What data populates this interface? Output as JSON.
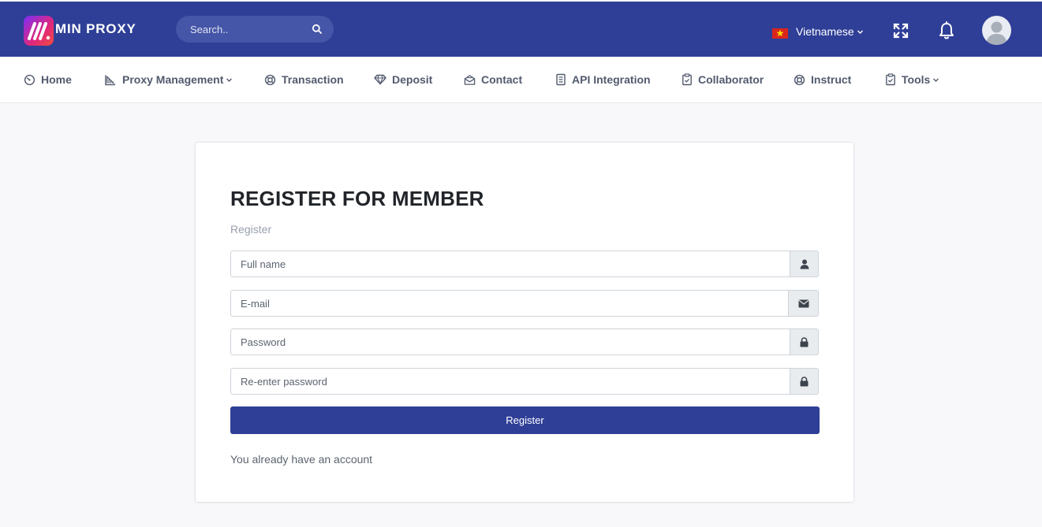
{
  "header": {
    "brand": "MIN PROXY",
    "search_placeholder": "Search..",
    "language": "Vietnamese"
  },
  "nav": [
    {
      "label": "Home",
      "icon": "dashboard-icon"
    },
    {
      "label": "Proxy Management",
      "icon": "chart-icon",
      "dropdown": true
    },
    {
      "label": "Transaction",
      "icon": "lifebuoy-icon"
    },
    {
      "label": "Deposit",
      "icon": "diamond-icon"
    },
    {
      "label": "Contact",
      "icon": "envelope-open-icon"
    },
    {
      "label": "API Integration",
      "icon": "document-icon"
    },
    {
      "label": "Collaborator",
      "icon": "clipboard-icon"
    },
    {
      "label": "Instruct",
      "icon": "lifebuoy-icon"
    },
    {
      "label": "Tools",
      "icon": "clipboard-icon",
      "dropdown": true
    }
  ],
  "form": {
    "title": "REGISTER FOR MEMBER",
    "subtitle": "Register",
    "fields": [
      {
        "placeholder": "Full name",
        "icon": "user-icon"
      },
      {
        "placeholder": "E-mail",
        "icon": "envelope-icon"
      },
      {
        "placeholder": "Password",
        "icon": "lock-icon"
      },
      {
        "placeholder": "Re-enter password",
        "icon": "lock-icon"
      }
    ],
    "submit_label": "Register",
    "login_link": "You already have an account"
  },
  "colors": {
    "primary": "#2f3f97",
    "background": "#f8f8fa"
  }
}
